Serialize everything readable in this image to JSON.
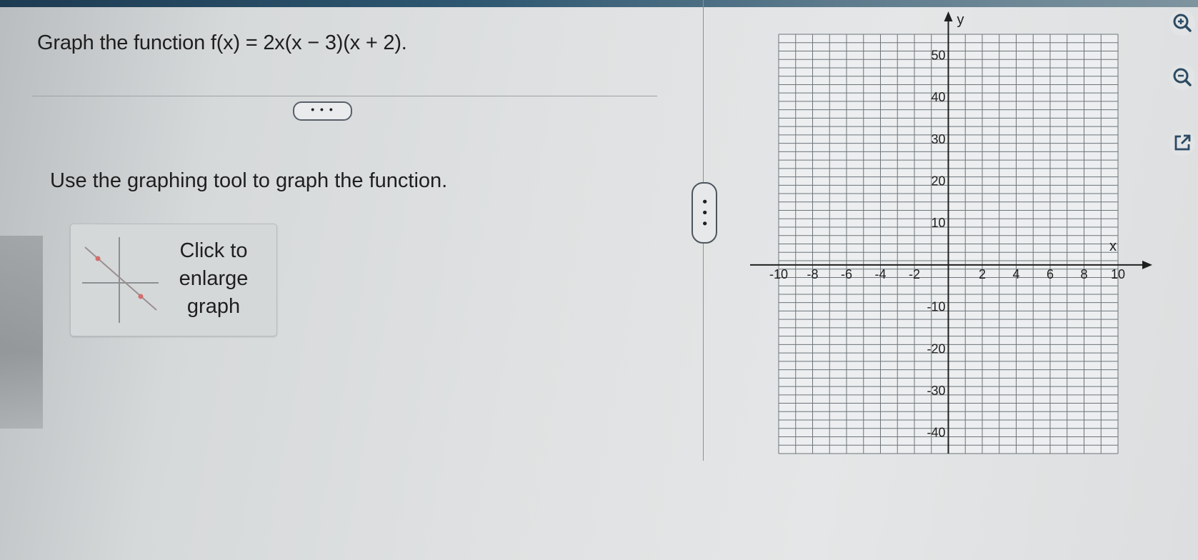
{
  "question": {
    "text": "Graph the function f(x) = 2x(x − 3)(x + 2)."
  },
  "more_button": {
    "label": "• • •"
  },
  "instruction": {
    "text": "Use the graphing tool to graph the function."
  },
  "enlarge": {
    "label_line1": "Click to",
    "label_line2": "enlarge",
    "label_line3": "graph"
  },
  "splitter": {
    "label": "• • •"
  },
  "graph": {
    "x_label": "x",
    "y_label": "y",
    "x_ticks": [
      "-10",
      "-8",
      "-6",
      "-4",
      "-2",
      "2",
      "4",
      "6",
      "8",
      "10"
    ],
    "y_ticks": [
      "50",
      "40",
      "30",
      "20",
      "10",
      "-10",
      "-20",
      "-30",
      "-40"
    ],
    "x_range": [
      -10,
      10
    ],
    "y_range": [
      -45,
      55
    ]
  },
  "tools": {
    "zoom_in_icon": "zoom-in-icon",
    "zoom_out_icon": "zoom-out-icon",
    "popout_icon": "external-link-icon",
    "accent_color": "#2c4a63"
  }
}
